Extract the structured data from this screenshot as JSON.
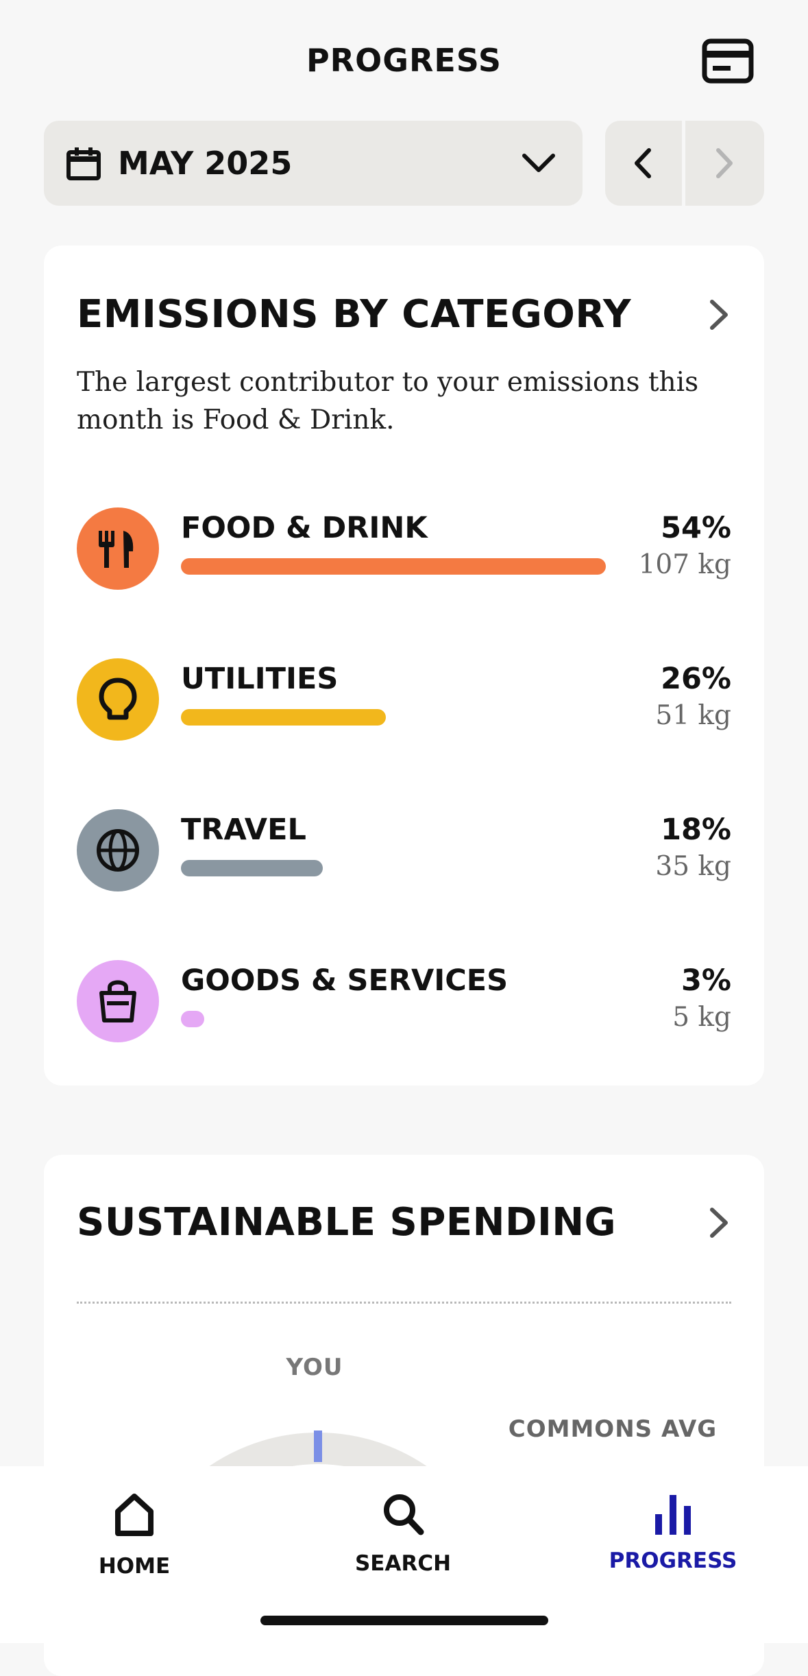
{
  "header": {
    "title": "PROGRESS",
    "card_icon": "credit-card-icon"
  },
  "period": {
    "selected": "MAY 2025",
    "calendar_icon": "calendar-icon",
    "dropdown_icon": "chevron-down-icon",
    "prev_icon": "chevron-left-icon",
    "next_icon": "chevron-right-icon"
  },
  "emissions": {
    "heading": "EMISSIONS BY CATEGORY",
    "description": "The largest contributor to your emissions this month is Food & Drink.",
    "categories": [
      {
        "name": "FOOD & DRINK",
        "percent": "54%",
        "amount": "107 kg",
        "share": 0.54,
        "icon": "fork-knife-icon",
        "color": "#f47a42"
      },
      {
        "name": "UTILITIES",
        "percent": "26%",
        "amount": "51 kg",
        "share": 0.26,
        "icon": "lightbulb-icon",
        "color": "#f2b71c"
      },
      {
        "name": "TRAVEL",
        "percent": "18%",
        "amount": "35 kg",
        "share": 0.18,
        "icon": "globe-icon",
        "color": "#8a97a1"
      },
      {
        "name": "GOODS & SERVICES",
        "percent": "3%",
        "amount": "5 kg",
        "share": 0.03,
        "icon": "shopping-bag-icon",
        "color": "#e5a8f5"
      }
    ]
  },
  "sustainable": {
    "heading": "SUSTAINABLE SPENDING",
    "you_label": "YOU",
    "avg_label": "COMMONS AVG",
    "you_marker_color": "#7b8fe6"
  },
  "tabs": [
    {
      "label": "HOME",
      "icon": "home-icon",
      "active": false
    },
    {
      "label": "SEARCH",
      "icon": "search-icon",
      "active": false
    },
    {
      "label": "PROGRESS",
      "icon": "bar-chart-icon",
      "active": true
    }
  ],
  "colors": {
    "accent_active_tab": "#1a1aa6",
    "background": "#f7f7f7"
  }
}
